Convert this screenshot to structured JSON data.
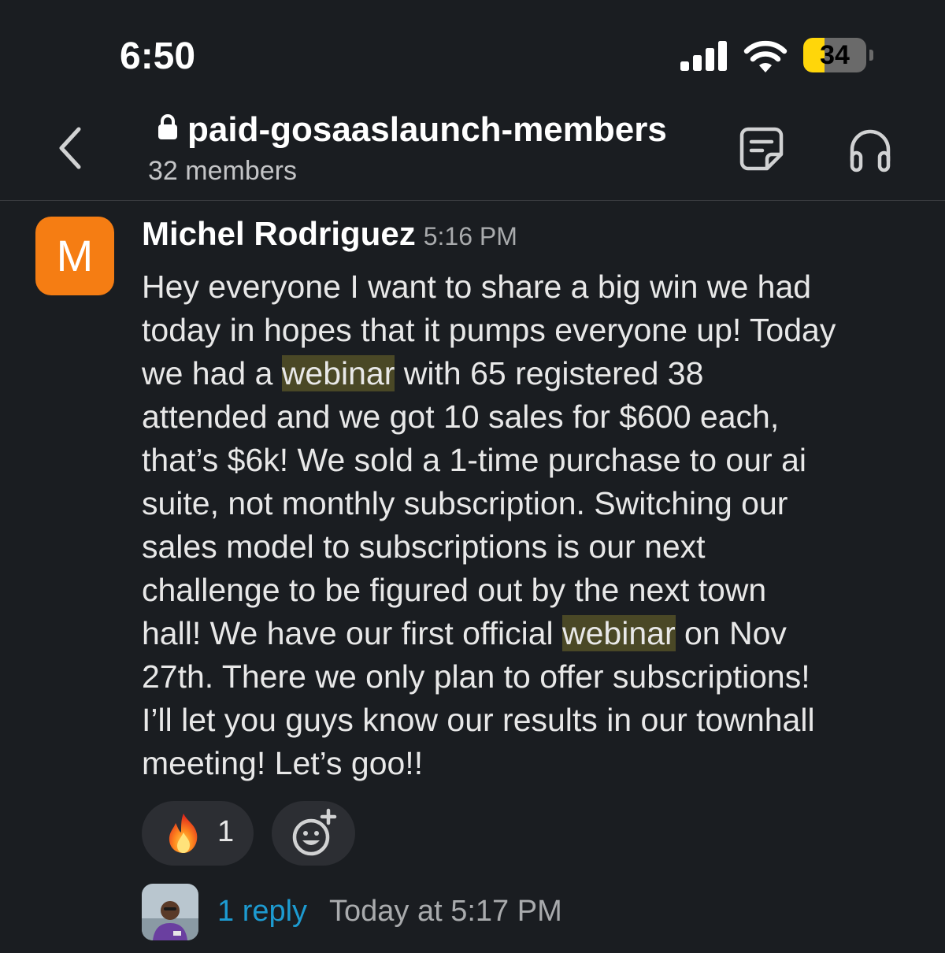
{
  "status_bar": {
    "time": "6:50",
    "battery_level": "34",
    "battery_fraction": 0.34,
    "icons": [
      "signal-icon",
      "wifi-icon",
      "battery-icon"
    ]
  },
  "header": {
    "channel_name": "paid-gosaaslaunch-members",
    "member_count": "32 members",
    "icons": [
      "back-chevron-icon",
      "lock-icon",
      "canvas-icon",
      "huddle-headphones-icon"
    ]
  },
  "message": {
    "avatar_initial": "M",
    "author": "Michel Rodriguez",
    "time": "5:16 PM",
    "lines": [
      [
        "Hey everyone I want to share a big win we had"
      ],
      [
        "today in hopes that it pumps everyone up! Today"
      ],
      [
        "we had a ",
        "webinar",
        " with 65 registered 38"
      ],
      [
        "attended and we got 10 sales for $600 each,"
      ],
      [
        "that’s $6k! We sold a 1-time purchase to our ai"
      ],
      [
        "suite, not monthly subscription. Switching our"
      ],
      [
        "sales model to subscriptions is our next"
      ],
      [
        "challenge to be figured out by the next town"
      ],
      [
        "hall! We have our first official ",
        "webinar",
        " on Nov"
      ],
      [
        "27th. There we only plan to offer subscriptions!"
      ],
      [
        "I’ll let you guys know our results in our townhall"
      ],
      [
        "meeting! Let’s goo!!"
      ]
    ],
    "highlight_word": "webinar",
    "reactions": [
      {
        "emoji": "fire-icon",
        "count": "1"
      }
    ],
    "add_reaction_icon": "add-emoji-icon",
    "thread": {
      "reply_link": "1 reply",
      "reply_time": "Today at 5:17 PM"
    }
  },
  "colors": {
    "background": "#1a1d21",
    "avatar": "#f57d13",
    "link": "#1d9bd1",
    "highlight": "#4a4826",
    "battery": "#ffd60a"
  }
}
